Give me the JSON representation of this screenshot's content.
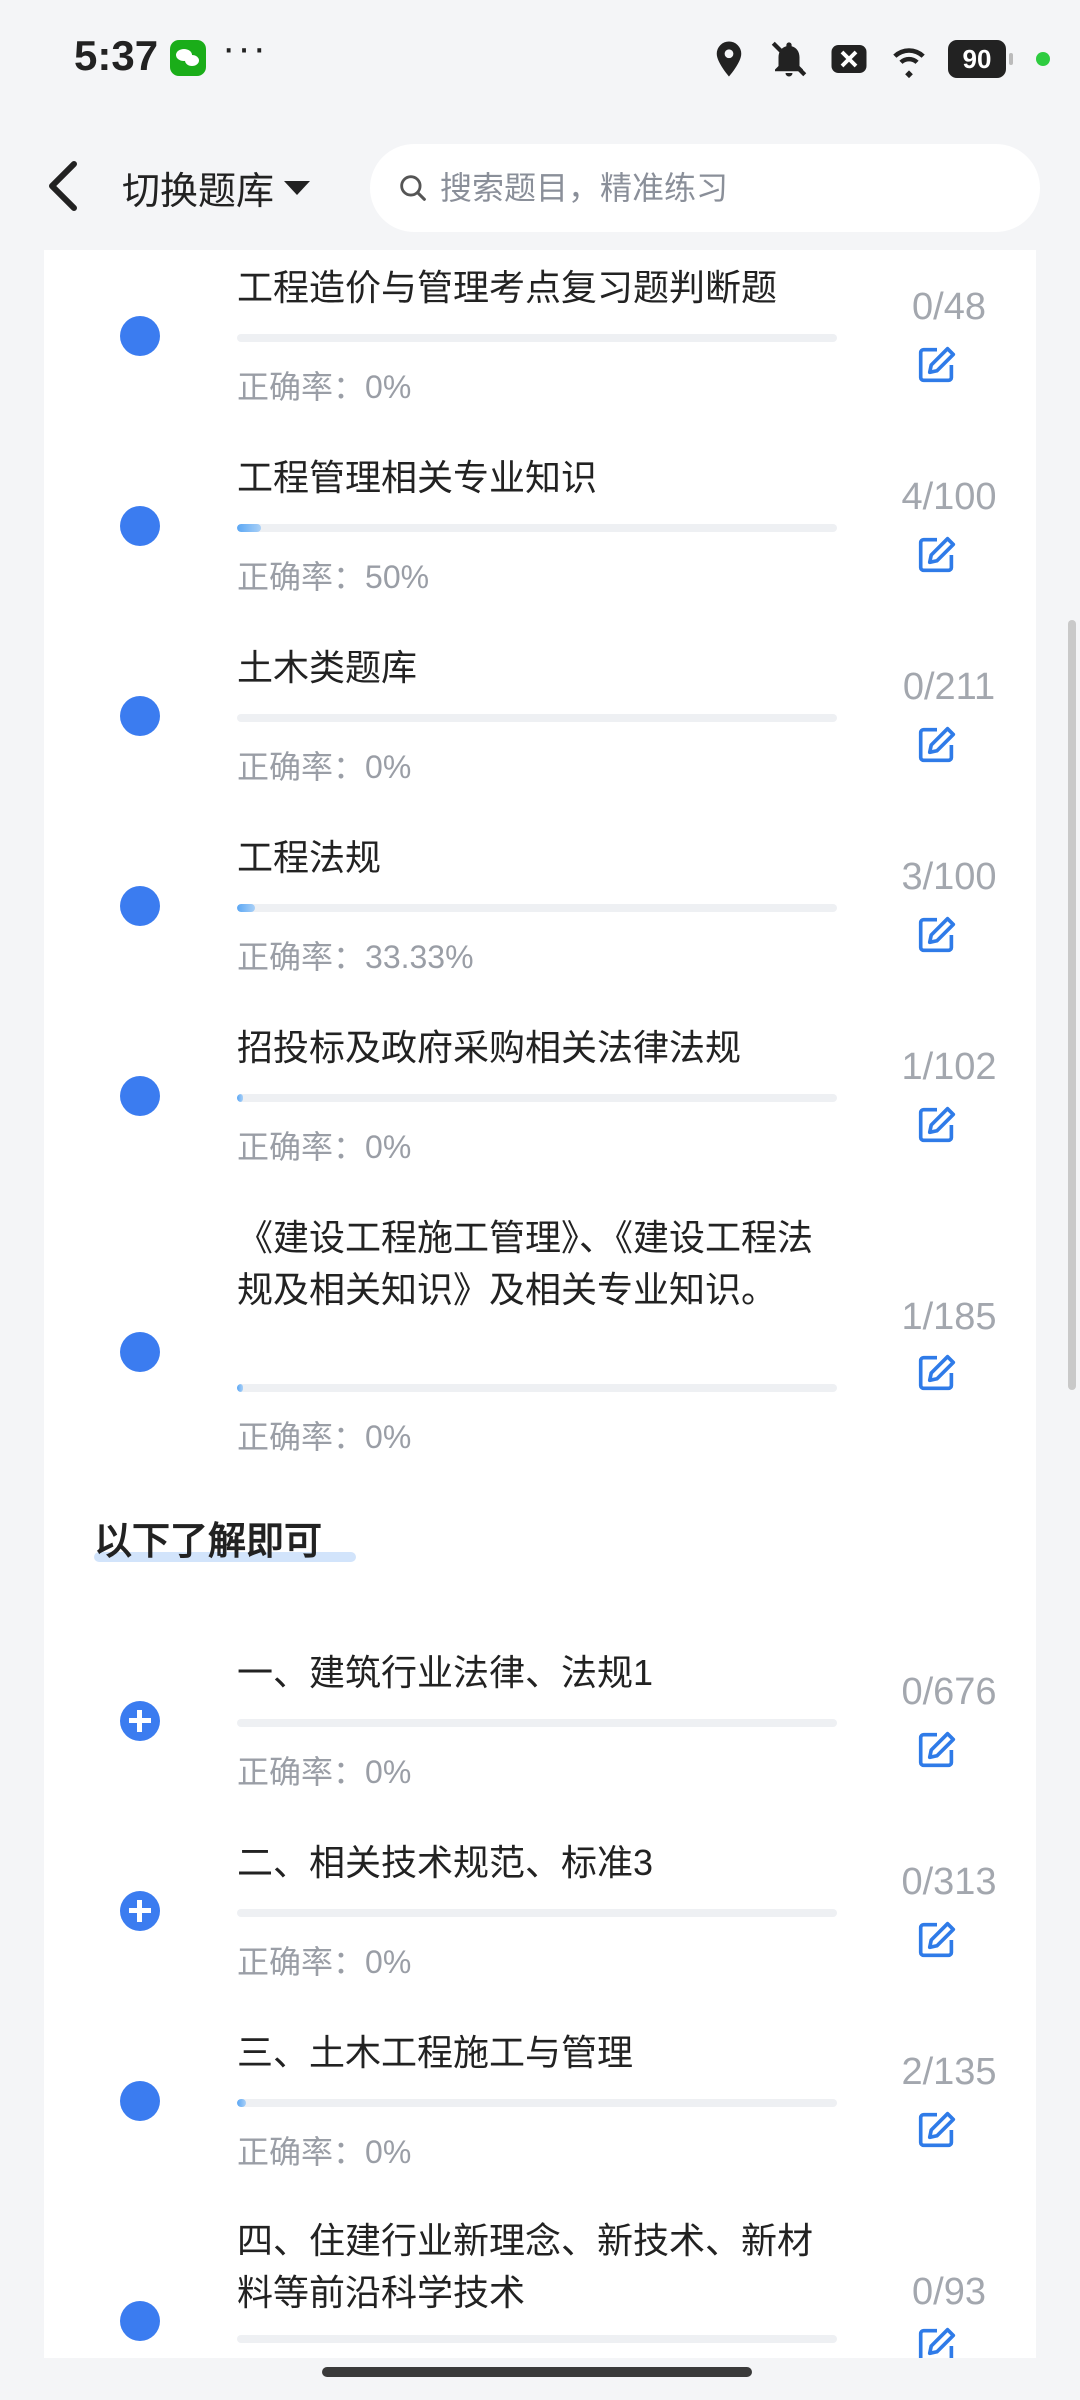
{
  "status_bar": {
    "time": "5:37",
    "more": "···",
    "battery": "90"
  },
  "header": {
    "title": "切换题库",
    "search_placeholder": "搜索题目，精准练习"
  },
  "accuracy_label": "正确率：",
  "section_title": "以下了解即可",
  "items_top": [
    {
      "title": "工程造价与管理考点复习题判断题",
      "accuracy": "0%",
      "count": "0/48",
      "progress": 0,
      "marker": "dot"
    },
    {
      "title": "工程管理相关专业知识",
      "accuracy": "50%",
      "count": "4/100",
      "progress": 0.04,
      "marker": "dot"
    },
    {
      "title": "土木类题库",
      "accuracy": "0%",
      "count": "0/211",
      "progress": 0,
      "marker": "dot"
    },
    {
      "title": "工程法规",
      "accuracy": "33.33%",
      "count": "3/100",
      "progress": 0.03,
      "marker": "dot"
    },
    {
      "title": "招投标及政府采购相关法律法规",
      "accuracy": "0%",
      "count": "1/102",
      "progress": 0.01,
      "marker": "dot"
    },
    {
      "title": "《建设工程施工管理》、《建设工程法规及相关知识》及相关专业知识。",
      "accuracy": "0%",
      "count": "1/185",
      "progress": 0.005,
      "marker": "dot"
    }
  ],
  "items_bottom": [
    {
      "title": "一、建筑行业法律、法规1",
      "accuracy": "0%",
      "count": "0/676",
      "progress": 0,
      "marker": "plus"
    },
    {
      "title": "二、相关技术规范、标准3",
      "accuracy": "0%",
      "count": "0/313",
      "progress": 0,
      "marker": "plus"
    },
    {
      "title": "三、土木工程施工与管理",
      "accuracy": "0%",
      "count": "2/135",
      "progress": 0.015,
      "marker": "dot"
    },
    {
      "title": "四、住建行业新理念、新技术、新材料等前沿科学技术",
      "accuracy": "",
      "count": "0/93",
      "progress": 0,
      "marker": "dot"
    }
  ],
  "colors": {
    "accent": "#3b7cf0",
    "progress": "#5ba7f4",
    "muted_text": "#9a9ea6"
  }
}
